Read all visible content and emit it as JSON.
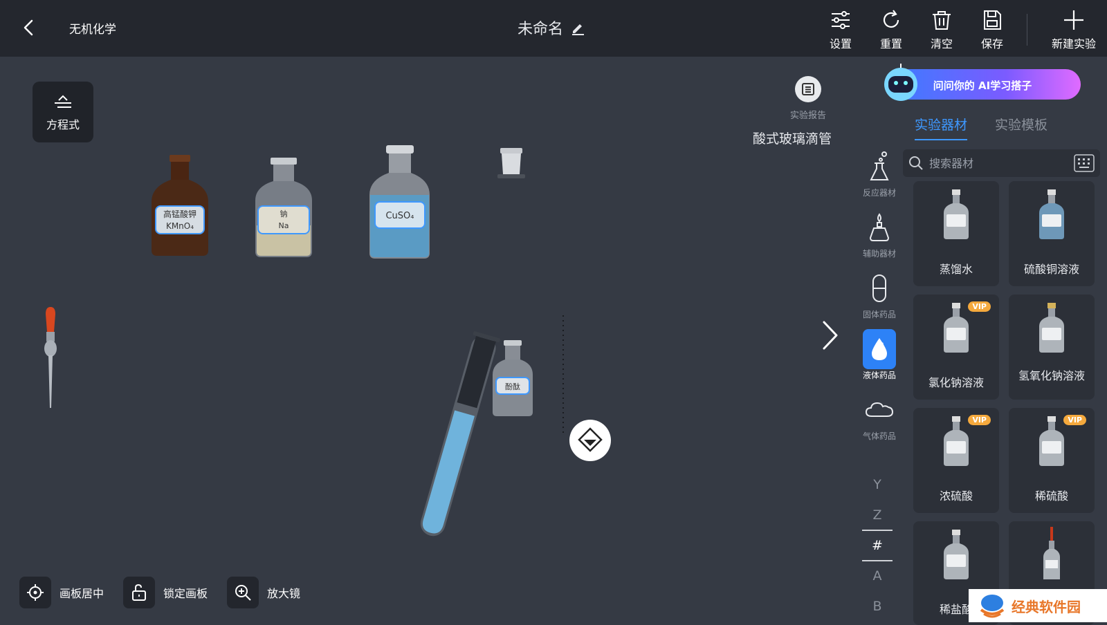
{
  "header": {
    "crumb": "无机化学",
    "title": "未命名",
    "buttons": [
      {
        "label": "设置",
        "icon": "sliders-icon"
      },
      {
        "label": "重置",
        "icon": "refresh-icon"
      },
      {
        "label": "清空",
        "icon": "trash-icon"
      },
      {
        "label": "保存",
        "icon": "save-icon"
      },
      {
        "label": "新建实验",
        "icon": "plus-icon"
      }
    ]
  },
  "canvas": {
    "equation_label": "方程式",
    "report_label": "实验报告",
    "selected_item": "酸式玻璃滴管",
    "bottles": [
      {
        "line1": "高锰酸钾",
        "line2": "KMnO₄"
      },
      {
        "line1": "钠",
        "line2": "Na"
      },
      {
        "line1": "",
        "line2": "CuSO₄"
      }
    ],
    "small_bottle_label": "酚酞"
  },
  "bottom_tools": [
    {
      "label": "画板居中",
      "icon": "crosshair-icon"
    },
    {
      "label": "锁定画板",
      "icon": "unlock-icon"
    },
    {
      "label": "放大镜",
      "icon": "zoom-in-icon"
    }
  ],
  "sidebar": {
    "ai_banner": "问问你的 AI学习搭子",
    "tabs": [
      "实验器材",
      "实验模板"
    ],
    "search_placeholder": "搜索器材",
    "categories": [
      {
        "label": "反应器材",
        "icon": "flask-icon"
      },
      {
        "label": "辅助器材",
        "icon": "burner-icon"
      },
      {
        "label": "固体药品",
        "icon": "capsule-icon"
      },
      {
        "label": "液体药品",
        "icon": "drop-icon"
      },
      {
        "label": "气体药品",
        "icon": "cloud-icon"
      }
    ],
    "letters": [
      "Y",
      "Z",
      "#",
      "A",
      "B"
    ],
    "items": [
      {
        "label": "蒸馏水",
        "vip": ""
      },
      {
        "label": "硫酸铜溶液",
        "vip": ""
      },
      {
        "label": "氯化钠溶液",
        "vip": "VIP"
      },
      {
        "label": "氢氧化钠溶液",
        "vip": ""
      },
      {
        "label": "浓硫酸",
        "vip": "VIP"
      },
      {
        "label": "稀硫酸",
        "vip": "VIP"
      },
      {
        "label": "稀盐酸",
        "vip": ""
      },
      {
        "label": "",
        "vip": ""
      }
    ]
  },
  "watermark": "经典软件园"
}
